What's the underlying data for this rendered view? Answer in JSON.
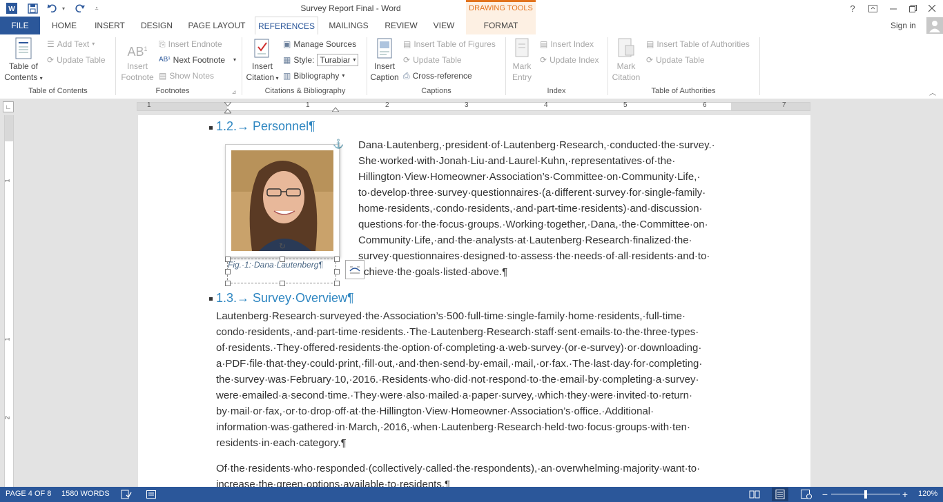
{
  "window": {
    "title": "Survey Report Final - Word",
    "drawing_tools": "DRAWING TOOLS",
    "sign_in": "Sign in"
  },
  "tabs": {
    "file": "FILE",
    "home": "HOME",
    "insert": "INSERT",
    "design": "DESIGN",
    "page_layout": "PAGE LAYOUT",
    "references": "REFERENCES",
    "mailings": "MAILINGS",
    "review": "REVIEW",
    "view": "VIEW",
    "format": "FORMAT"
  },
  "ribbon": {
    "toc": {
      "line1": "Table of",
      "line2": "Contents",
      "add_text": "Add Text",
      "update_table": "Update Table",
      "group": "Table of Contents"
    },
    "footnotes": {
      "insert_line1": "Insert",
      "insert_line2": "Footnote",
      "insert_endnote": "Insert Endnote",
      "next_footnote": "Next Footnote",
      "show_notes": "Show Notes",
      "group": "Footnotes"
    },
    "citations": {
      "insert_line1": "Insert",
      "insert_line2": "Citation",
      "manage_sources": "Manage Sources",
      "style_label": "Style:",
      "style_value": "Turabian",
      "bibliography": "Bibliography",
      "group": "Citations & Bibliography"
    },
    "captions": {
      "insert_line1": "Insert",
      "insert_line2": "Caption",
      "insert_tof": "Insert Table of Figures",
      "update_table": "Update Table",
      "cross_reference": "Cross-reference",
      "group": "Captions"
    },
    "index": {
      "mark_line1": "Mark",
      "mark_line2": "Entry",
      "insert_index": "Insert Index",
      "update_index": "Update Index",
      "group": "Index"
    },
    "toa": {
      "mark_line1": "Mark",
      "mark_line2": "Citation",
      "insert_toa": "Insert Table of Authorities",
      "update_table": "Update Table",
      "group": "Table of Authorities"
    }
  },
  "ruler": {
    "numbers": [
      "1",
      "1",
      "2",
      "3",
      "4",
      "5",
      "6",
      "7"
    ]
  },
  "vruler": {
    "numbers": [
      "1",
      "1",
      "2"
    ]
  },
  "document": {
    "heading1": "1.2.→ Personnel¶",
    "para1_lines": [
      "Dana·Lautenberg,·president·of·Lautenberg·Research,·conducted·the·survey.·",
      "She·worked·with·Jonah·Liu·and·Laurel·Kuhn,·representatives·of·the·",
      "Hillington·View·Homeowner·Association’s·Committee·on·Community·Life,·",
      "to·develop·three·survey·questionnaires·(a·different·survey·for·single-family·",
      "home·residents,·condo·residents,·and·part-time·residents)·and·discussion·",
      "questions·for·the·focus·groups.·Working·together,·Dana,·the·Committee·on·",
      "Community·Life,·and·the·analysts·at·Lautenberg·Research·finalized·the·",
      "survey·questionnaires·designed·to·assess·the·needs·of·all·residents·and·to·",
      "chieve·the·goals·listed·above.¶"
    ],
    "caption": "Fig.·1:·Dana·Lautenberg¶",
    "heading2": "1.3.→ Survey·Overview¶",
    "para2_lines": [
      "Lautenberg·Research·surveyed·the·Association’s·500·full-time·single-family·home·residents,·full-time·",
      "condo·residents,·and·part-time·residents.·The·Lautenberg·Research·staff·sent·emails·to·the·three·types·",
      "of·residents.·They·offered·residents·the·option·of·completing·a·web·survey·(or·e-survey)·or·downloading·",
      "a·PDF·file·that·they·could·print,·fill·out,·and·then·send·by·email,·mail,·or·fax.·The·last·day·for·completing·",
      "the·survey·was·February·10,·2016.·Residents·who·did·not·respond·to·the·email·by·completing·a·survey·",
      "were·emailed·a·second·time.·They·were·also·mailed·a·paper·survey,·which·they·were·invited·to·return·",
      "by·mail·or·fax,·or·to·drop·off·at·the·Hillington·View·Homeowner·Association’s·office.·Additional·",
      "information·was·gathered·in·March,·2016,·when·Lautenberg·Research·held·two·focus·groups·with·ten·",
      "residents·in·each·category.¶"
    ],
    "para3_lines": [
      "Of·the·residents·who·responded·(collectively·called·the·respondents),·an·overwhelming·majority·want·to·",
      "increase·the·green·options·available·to·residents.¶"
    ]
  },
  "status": {
    "page": "PAGE 4 OF 8",
    "words": "1580 WORDS",
    "zoom": "120%",
    "zoom_minus": "−",
    "zoom_plus": "+"
  },
  "colors": {
    "word_blue": "#2b579a",
    "heading_blue": "#2e86c1",
    "drawing_tools_orange": "#e2731d"
  }
}
